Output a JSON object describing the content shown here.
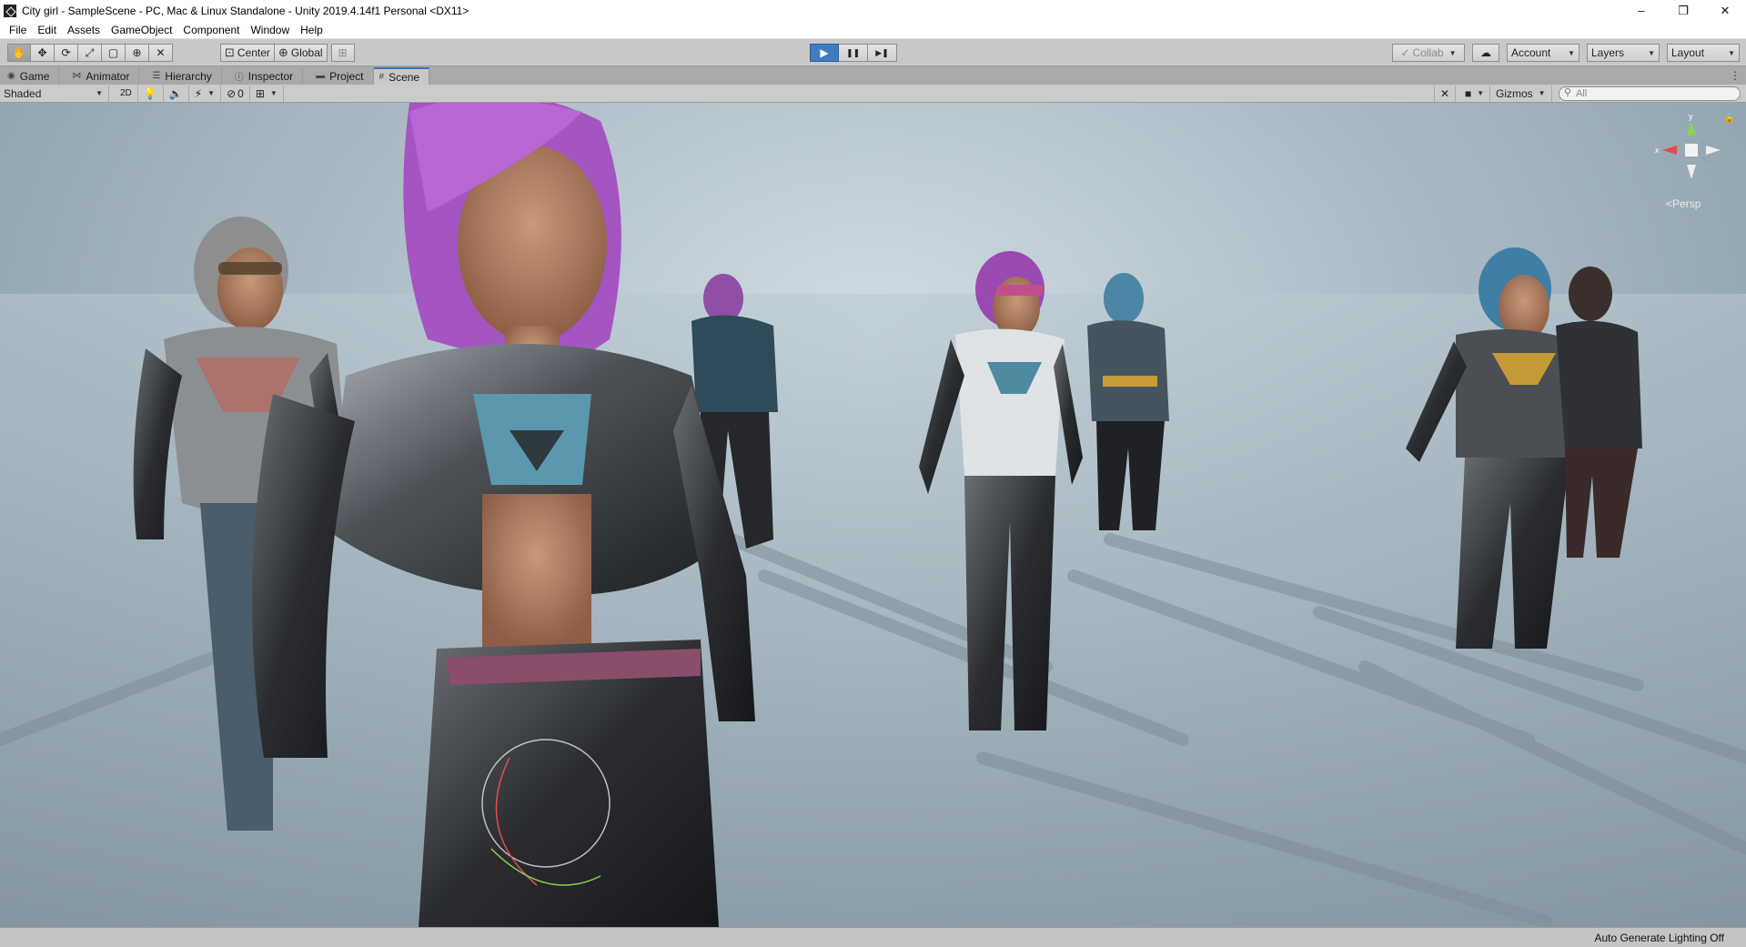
{
  "window": {
    "title": "City girl - SampleScene - PC, Mac & Linux Standalone - Unity 2019.4.14f1 Personal <DX11>",
    "controls": {
      "minimize": "–",
      "restore": "❐",
      "close": "✕"
    }
  },
  "menu": [
    "File",
    "Edit",
    "Assets",
    "GameObject",
    "Component",
    "Window",
    "Help"
  ],
  "toolbar": {
    "transform_tools": [
      "hand-tool",
      "move-tool",
      "rotate-tool",
      "scale-tool",
      "rect-tool",
      "transform-tool",
      "custom-tool"
    ],
    "pivot_label": "Center",
    "space_label": "Global",
    "playback": {
      "play": "▶",
      "pause": "❚❚",
      "step": "▶❚"
    },
    "collab_label": "Collab",
    "account_label": "Account",
    "layers_label": "Layers",
    "layout_label": "Layout"
  },
  "tabs": [
    {
      "label": "Game",
      "icon": "game-icon"
    },
    {
      "label": "Animator",
      "icon": "animator-icon"
    },
    {
      "label": "Hierarchy",
      "icon": "hierarchy-icon"
    },
    {
      "label": "Inspector",
      "icon": "inspector-icon"
    },
    {
      "label": "Project",
      "icon": "folder-icon"
    },
    {
      "label": "Scene",
      "icon": "scene-icon",
      "active": true
    }
  ],
  "scene_toolbar": {
    "draw_mode": "Shaded",
    "mode_2d": "2D",
    "hidden_count": "0",
    "gizmos_label": "Gizmos",
    "search_placeholder": "All"
  },
  "scene_view": {
    "projection_label": "Persp",
    "axis_labels": {
      "x": "x",
      "y": "y"
    }
  },
  "status": {
    "lighting": "Auto Generate Lighting Off"
  }
}
